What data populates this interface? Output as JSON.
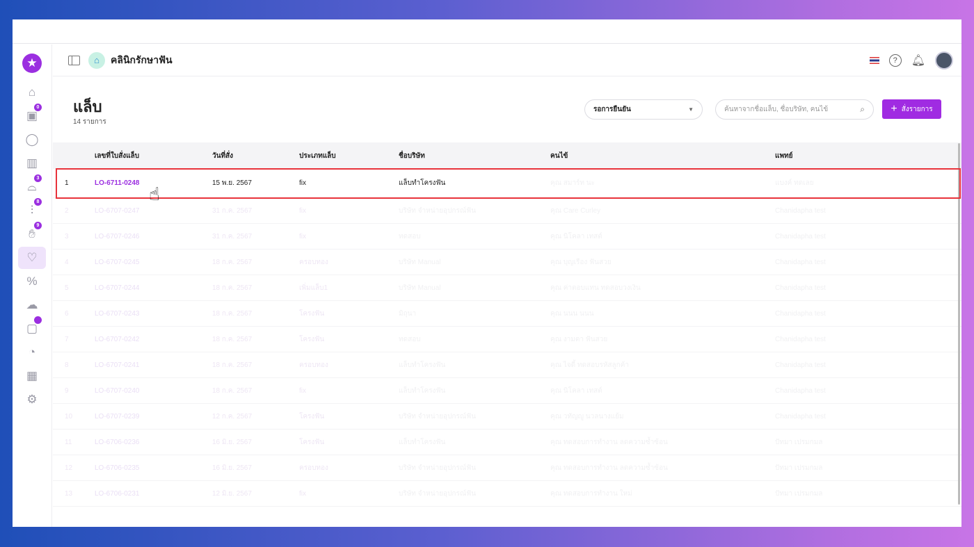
{
  "header": {
    "clinic_name": "คลินิกรักษาฟัน",
    "help": "?"
  },
  "sidebar": {
    "items": [
      {
        "icon": "home-icon",
        "badge": null
      },
      {
        "icon": "calendar-icon",
        "badge": "0"
      },
      {
        "icon": "user-icon",
        "badge": null
      },
      {
        "icon": "board-icon",
        "badge": null
      },
      {
        "icon": "dental-chair-icon",
        "badge": "3"
      },
      {
        "icon": "tools-icon",
        "badge": "8"
      },
      {
        "icon": "hand-coin-icon",
        "badge": "9"
      },
      {
        "icon": "tooth-icon",
        "badge": null,
        "active": true
      },
      {
        "icon": "percent-icon",
        "badge": null
      },
      {
        "icon": "cloud-icon",
        "badge": null
      },
      {
        "icon": "package-icon",
        "badge": ""
      },
      {
        "icon": "gauge-icon",
        "badge": null
      },
      {
        "icon": "chart-icon",
        "badge": null
      },
      {
        "icon": "gear-icon",
        "badge": null
      }
    ]
  },
  "page": {
    "title": "แล็บ",
    "count": "14 รายการ"
  },
  "filter": {
    "selected": "รอการยืนยัน"
  },
  "search": {
    "placeholder": "ค้นหาจากชื่อแล็บ, ชื่อบริษัท, คนไข้"
  },
  "add_button": "สั่งรายการ",
  "table": {
    "columns": [
      "",
      "เลขที่ใบสั่งแล็บ",
      "วันที่สั่ง",
      "ประเภทแล็บ",
      "ชื่อบริษัท",
      "คนไข้",
      "แพทย์"
    ],
    "rows": [
      [
        "1",
        "LO-6711-0248",
        "15 พ.ย. 2567",
        "fix",
        "แล็บทำโครงฟัน",
        "คุณ สมาร์ท นะ",
        "แบงค์ ทดเลย"
      ],
      [
        "2",
        "LO-6707-0247",
        "31 ก.ค. 2567",
        "fix",
        "บริษัท จำหน่ายอุปกรณ์ฟัน",
        "คุณ Care Curley",
        "Chanidapha test"
      ],
      [
        "3",
        "LO-6707-0246",
        "31 ก.ค. 2567",
        "fix",
        "ทดสอบ",
        "คุณ นิโคลา เทสต์",
        "Chanidapha test"
      ],
      [
        "4",
        "LO-6707-0245",
        "18 ก.ค. 2567",
        "ครอบทอง",
        "บริษัท Manual",
        "คุณ บุญเรือง ฟันสวย",
        "Chanidapha test"
      ],
      [
        "5",
        "LO-6707-0244",
        "18 ก.ค. 2567",
        "เพิ่มแล็บ1",
        "บริษัท Manual",
        "คุณ ค่าตอบแทน ทดสอบวงเงิน",
        "Chanidapha test"
      ],
      [
        "6",
        "LO-6707-0243",
        "18 ก.ค. 2567",
        "โครงฟัน",
        "มิถุนา",
        "คุณ นนน นนน",
        "Chanidapha test"
      ],
      [
        "7",
        "LO-6707-0242",
        "18 ก.ค. 2567",
        "โครงฟัน",
        "ทดสอบ",
        "คุณ งามตา ฟันสวย",
        "Chanidapha test"
      ],
      [
        "8",
        "LO-6707-0241",
        "18 ก.ค. 2567",
        "ครอบทอง",
        "แล็บทำโครงฟัน",
        "คุณ ไจดี้ ทดสอบรหัสลูกค้า",
        "Chanidapha test"
      ],
      [
        "9",
        "LO-6707-0240",
        "18 ก.ค. 2567",
        "fix",
        "แล็บทำโครงฟัน",
        "คุณ นิโคลา เทสต์",
        "Chanidapha test"
      ],
      [
        "10",
        "LO-6707-0239",
        "12 ก.ค. 2567",
        "โครงฟัน",
        "บริษัท จำหน่ายอุปกรณ์ฟัน",
        "คุณ วทัญญู นวลนางแย้ม",
        "Chanidapha test"
      ],
      [
        "11",
        "LO-6706-0236",
        "16 มิ.ย. 2567",
        "โครงฟัน",
        "แล็บทำโครงฟัน",
        "คุณ ทดสอบการทำงาน ลดความซ้ำซ้อน",
        "ปัทมา เปรมกมล"
      ],
      [
        "12",
        "LO-6706-0235",
        "16 มิ.ย. 2567",
        "ครอบทอง",
        "บริษัท จำหน่ายอุปกรณ์ฟัน",
        "คุณ ทดสอบการทำงาน ลดความซ้ำซ้อน",
        "ปัทมา เปรมกมล"
      ],
      [
        "13",
        "LO-6706-0231",
        "12 มิ.ย. 2567",
        "fix",
        "บริษัท จำหน่ายอุปกรณ์ฟัน",
        "คุณ ทดสอบการทำงาน ใหม่",
        "ปัทมา เปรมกมล"
      ]
    ]
  },
  "colors": {
    "accent": "#a02be2",
    "highlight": "#e8323a"
  }
}
